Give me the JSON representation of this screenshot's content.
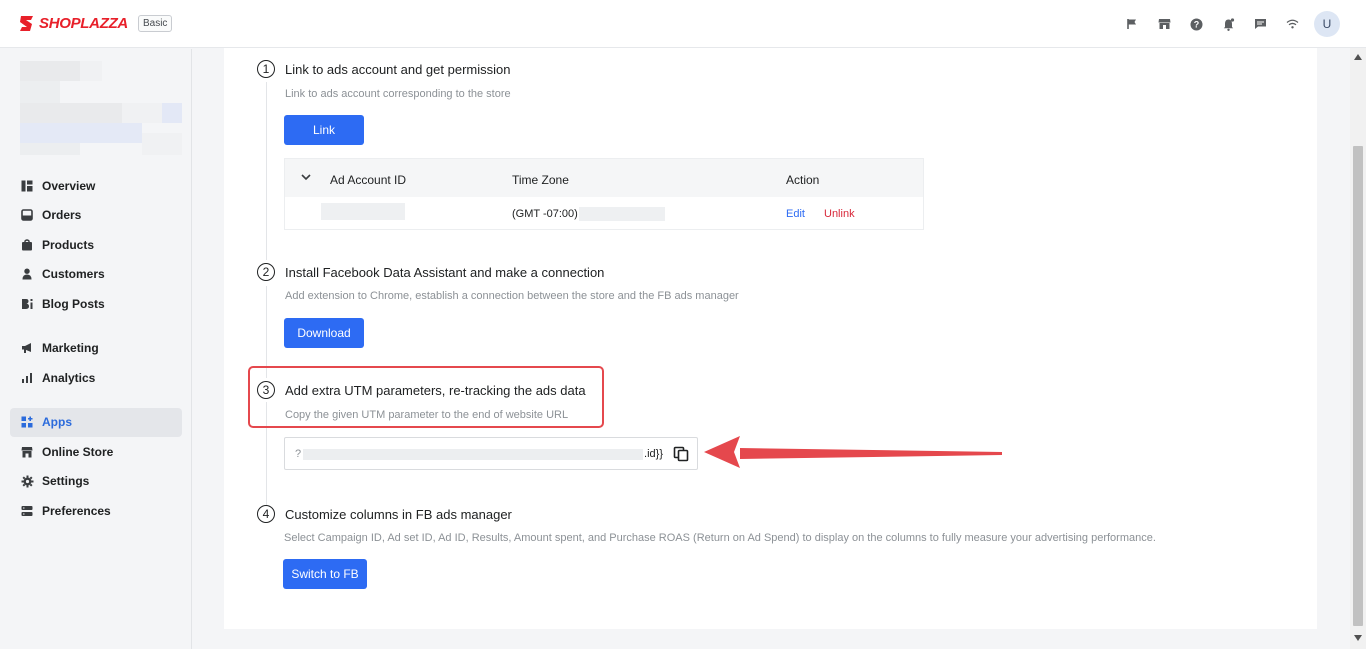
{
  "header": {
    "logo_text": "SHOPLAZZA",
    "plan_badge": "Basic",
    "icons": [
      "flag-icon",
      "store-icon",
      "help-icon",
      "bell-icon",
      "chat-icon",
      "wifi-icon"
    ],
    "avatar_letter": "U"
  },
  "sidebar": {
    "items": [
      {
        "label": "Overview",
        "icon": "overview-icon"
      },
      {
        "label": "Orders",
        "icon": "orders-icon"
      },
      {
        "label": "Products",
        "icon": "products-icon"
      },
      {
        "label": "Customers",
        "icon": "customers-icon"
      },
      {
        "label": "Blog Posts",
        "icon": "blog-icon"
      },
      {
        "label": "Marketing",
        "icon": "megaphone-icon"
      },
      {
        "label": "Analytics",
        "icon": "analytics-icon"
      },
      {
        "label": "Apps",
        "icon": "apps-icon",
        "active": true
      },
      {
        "label": "Online Store",
        "icon": "store-icon"
      },
      {
        "label": "Settings",
        "icon": "gear-icon"
      },
      {
        "label": "Preferences",
        "icon": "preferences-icon"
      }
    ]
  },
  "steps": [
    {
      "number": "1",
      "title": "Link to ads account and get permission",
      "desc": "Link to ads account corresponding to the store",
      "button": "Link"
    },
    {
      "number": "2",
      "title": "Install Facebook Data Assistant and make a connection",
      "desc": "Add extension to Chrome, establish a connection between the store and the FB ads manager",
      "button": "Download"
    },
    {
      "number": "3",
      "title": "Add extra UTM parameters, re-tracking the ads data",
      "desc": "Copy the given UTM parameter to the end of website URL"
    },
    {
      "number": "4",
      "title": "Customize columns in FB ads manager",
      "desc": "Select Campaign ID, Ad set ID, Ad ID, Results, Amount spent, and Purchase ROAS (Return on Ad Spend) to display on the columns to fully measure your advertising performance.",
      "button": "Switch to FB"
    }
  ],
  "account_table": {
    "headers": [
      "Ad Account ID",
      "Time Zone",
      "Action"
    ],
    "row": {
      "timezone": "(GMT -07:00)",
      "edit": "Edit",
      "unlink": "Unlink"
    }
  },
  "utm": {
    "prefix": "?",
    "suffix": ".id}}"
  },
  "colors": {
    "primary": "#2d6bf3",
    "danger": "#d8283a",
    "annotation": "#e5484d",
    "brand": "#e8202a"
  }
}
